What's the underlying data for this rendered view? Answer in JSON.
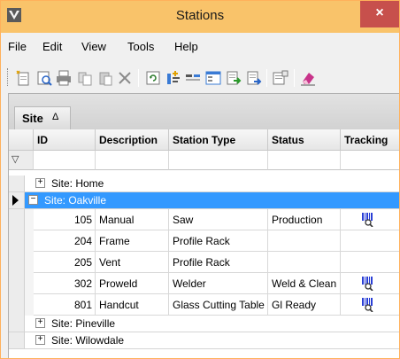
{
  "window": {
    "title": "Stations",
    "close_label": "×"
  },
  "menu": {
    "items": [
      "File",
      "Edit",
      "View",
      "Tools",
      "Help"
    ]
  },
  "groupby": {
    "label": "Site",
    "sort_indicator": "Δ"
  },
  "columns": [
    "ID",
    "Description",
    "Station Type",
    "Status",
    "Tracking"
  ],
  "groups": [
    {
      "label": "Site: Home",
      "expander": "+"
    },
    {
      "label": "Site: Oakville",
      "expander": "−"
    },
    {
      "label": "Site: Pineville",
      "expander": "+"
    },
    {
      "label": "Site: Wilowdale",
      "expander": "+"
    }
  ],
  "rows": [
    {
      "id": "105",
      "description": "Manual",
      "station_type": "Saw",
      "status": "Production",
      "tracking": true
    },
    {
      "id": "204",
      "description": "Frame",
      "station_type": "Profile Rack",
      "status": "",
      "tracking": false
    },
    {
      "id": "205",
      "description": "Vent",
      "station_type": "Profile Rack",
      "status": "",
      "tracking": false
    },
    {
      "id": "302",
      "description": "Proweld",
      "station_type": "Welder",
      "status": "Weld & Clean",
      "tracking": true
    },
    {
      "id": "801",
      "description": "Handcut",
      "station_type": "Glass Cutting Table",
      "status": "Gl Ready",
      "tracking": true
    }
  ],
  "colors": {
    "titlebar": "#f9c36a",
    "close": "#c7504c",
    "selection": "#3399ff",
    "tracking_icon": "#2a3fd6"
  },
  "icons": {
    "filter": "funnel-icon",
    "tracking": "barcode-magnifier-icon"
  }
}
